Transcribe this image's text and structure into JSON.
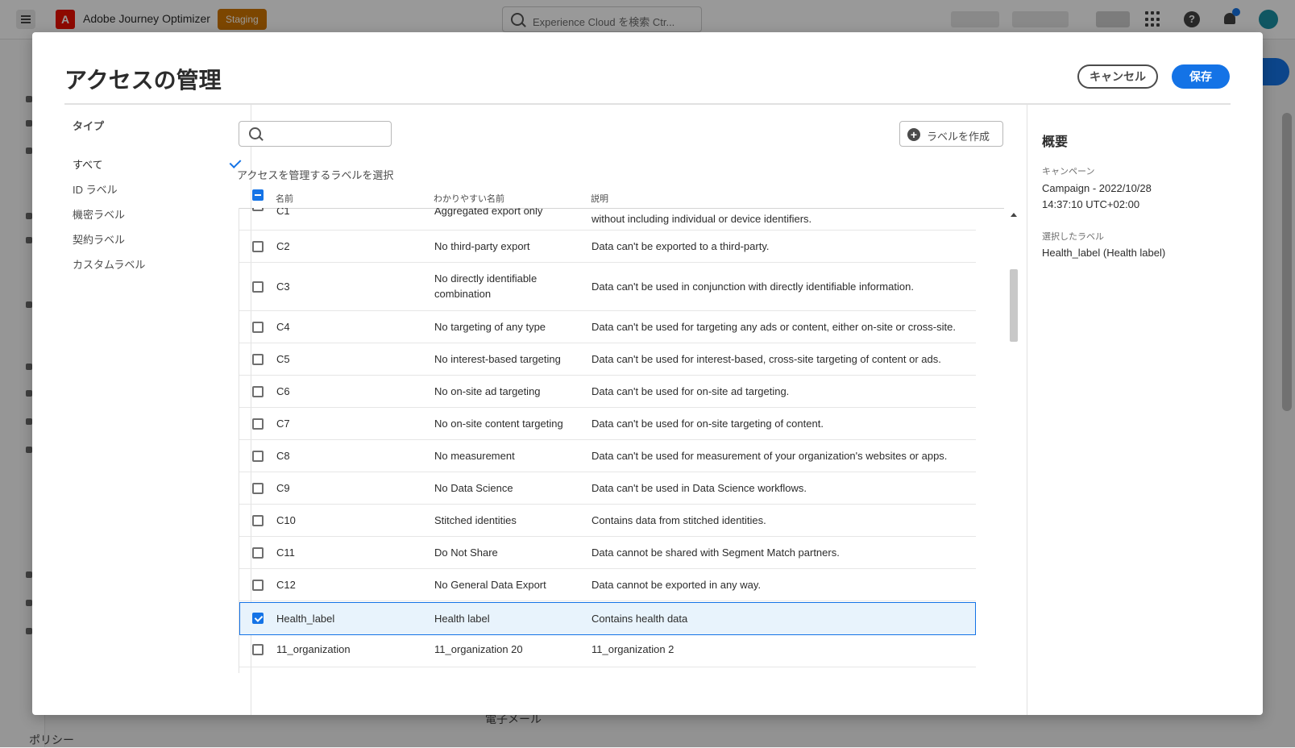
{
  "app": {
    "name": "Adobe Journey Optimizer",
    "env_badge": "Staging",
    "search_placeholder": "Experience Cloud を検索 Ctr..."
  },
  "background": {
    "left_nav_policy": "ポリシー",
    "email_label": "電子メール"
  },
  "dialog": {
    "title": "アクセスの管理",
    "cancel_label": "キャンセル",
    "save_label": "保存",
    "type_panel": {
      "heading": "タイプ",
      "items": [
        {
          "label": "すべて",
          "selected": true
        },
        {
          "label": "ID ラベル"
        },
        {
          "label": "機密ラベル"
        },
        {
          "label": "契約ラベル"
        },
        {
          "label": "カスタムラベル"
        }
      ]
    },
    "create_label_button": "ラベルを作成",
    "select_caption": "アクセスを管理するラベルを選択",
    "columns": {
      "name": "名前",
      "friendly": "わかりやすい名前",
      "desc": "説明"
    },
    "rows": [
      {
        "name": "C1",
        "friendly": "Aggregated export only",
        "desc": "without including individual or device identifiers.",
        "checked": false
      },
      {
        "name": "C2",
        "friendly": "No third-party export",
        "desc": "Data can't be exported to a third-party.",
        "checked": false
      },
      {
        "name": "C3",
        "friendly": "No directly identifiable combination",
        "desc": "Data can't be used in conjunction with directly identifiable information.",
        "checked": false
      },
      {
        "name": "C4",
        "friendly": "No targeting of any type",
        "desc": "Data can't be used for targeting any ads or content, either on-site or cross-site.",
        "checked": false
      },
      {
        "name": "C5",
        "friendly": "No interest-based targeting",
        "desc": "Data can't be used for interest-based, cross-site targeting of content or ads.",
        "checked": false
      },
      {
        "name": "C6",
        "friendly": "No on-site ad targeting",
        "desc": "Data can't be used for on-site ad targeting.",
        "checked": false
      },
      {
        "name": "C7",
        "friendly": "No on-site content targeting",
        "desc": "Data can't be used for on-site targeting of content.",
        "checked": false
      },
      {
        "name": "C8",
        "friendly": "No measurement",
        "desc": "Data can't be used for measurement of your organization's websites or apps.",
        "checked": false
      },
      {
        "name": "C9",
        "friendly": "No Data Science",
        "desc": "Data can't be used in Data Science workflows.",
        "checked": false
      },
      {
        "name": "C10",
        "friendly": "Stitched identities",
        "desc": "Contains data from stitched identities.",
        "checked": false
      },
      {
        "name": "C11",
        "friendly": "Do Not Share",
        "desc": "Data cannot be shared with Segment Match partners.",
        "checked": false
      },
      {
        "name": "C12",
        "friendly": "No General Data Export",
        "desc": "Data cannot be exported in any way.",
        "checked": false
      },
      {
        "name": "Health_label",
        "friendly": "Health label",
        "desc": "Contains health data",
        "checked": true
      },
      {
        "name": "11_organization",
        "friendly": "11_organization 20",
        "desc": "11_organization 2",
        "checked": false
      }
    ],
    "summary": {
      "title": "概要",
      "campaign_label": "キャンペーン",
      "campaign_value": "Campaign - 2022/10/28 14:37:10 UTC+02:00",
      "selected_label": "選択したラベル",
      "selected_value": "Health_label (Health label)"
    }
  },
  "colors": {
    "accent": "#1473e6",
    "badge": "#cf7500",
    "brand": "#eb1000"
  }
}
